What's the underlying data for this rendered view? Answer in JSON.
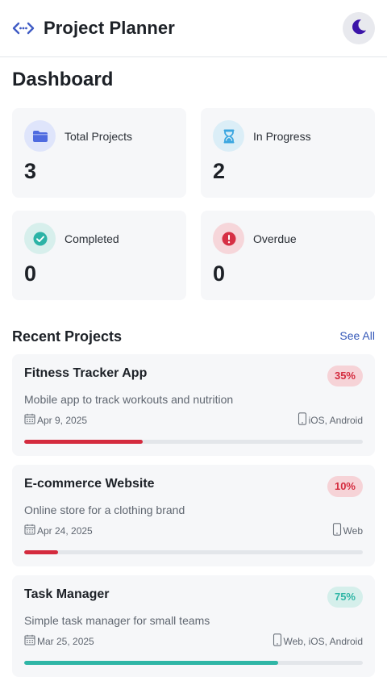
{
  "header": {
    "title": "Project Planner",
    "brand_icon": "code-arrows-icon",
    "theme_toggle_icon": "moon-icon"
  },
  "page": {
    "title": "Dashboard"
  },
  "stats": [
    {
      "label": "Total Projects",
      "value": "3",
      "icon": "folder-icon",
      "icon_color": "#4f6be0",
      "icon_bg": "#dfe5fb"
    },
    {
      "label": "In Progress",
      "value": "2",
      "icon": "hourglass-icon",
      "icon_color": "#3aa6e0",
      "icon_bg": "#dbeef7"
    },
    {
      "label": "Completed",
      "value": "0",
      "icon": "check-circle-icon",
      "icon_color": "#2bb3a6",
      "icon_bg": "#d7efec"
    },
    {
      "label": "Overdue",
      "value": "0",
      "icon": "alert-circle-icon",
      "icon_color": "#d62f44",
      "icon_bg": "#f6d6da"
    }
  ],
  "recent": {
    "title": "Recent Projects",
    "see_all": "See All",
    "projects": [
      {
        "name": "Fitness Tracker App",
        "description": "Mobile app to track workouts and nutrition",
        "date": "Apr 9, 2025",
        "platforms": "iOS, Android",
        "percent_label": "35%",
        "progress": 0.35,
        "color": "#d42b3e",
        "badge_bg": "#f6d3d7"
      },
      {
        "name": "E-commerce Website",
        "description": "Online store for a clothing brand",
        "date": "Apr 24, 2025",
        "platforms": "Web",
        "percent_label": "10%",
        "progress": 0.1,
        "color": "#d42b3e",
        "badge_bg": "#f6d3d7"
      },
      {
        "name": "Task Manager",
        "description": "Simple task manager for small teams",
        "date": "Mar 25, 2025",
        "platforms": "Web, iOS, Android",
        "percent_label": "75%",
        "progress": 0.75,
        "color": "#2fb6a6",
        "badge_bg": "#d5efeb"
      }
    ]
  }
}
